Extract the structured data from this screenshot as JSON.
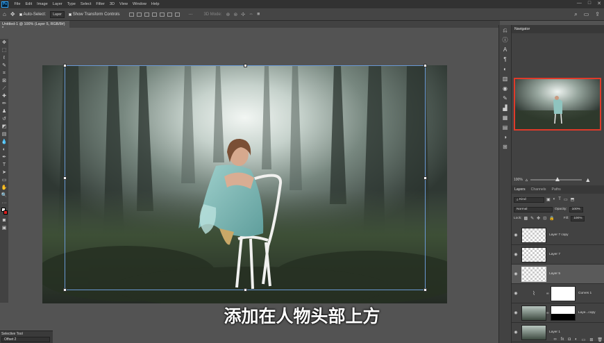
{
  "app": {
    "logo": "Ps",
    "window_controls": [
      "—",
      "□",
      "✕"
    ]
  },
  "menu": [
    "File",
    "Edit",
    "Image",
    "Layer",
    "Type",
    "Select",
    "Filter",
    "3D",
    "View",
    "Window",
    "Help"
  ],
  "options": {
    "auto_select_label": "Auto-Select:",
    "auto_select_value": "Layer",
    "show_transform_label": "Show Transform Controls",
    "mode_3d_label": "3D Mode:",
    "more_label": "···"
  },
  "document": {
    "tab_title": "Untitled-1 @ 100% (Layer 5, RGB/8#) *"
  },
  "subtitle": "添加在人物头部上方",
  "navigator": {
    "title": "Navigator",
    "zoom": "100%"
  },
  "layers_panel": {
    "tabs": [
      "Layers",
      "Channels",
      "Paths"
    ],
    "kind": "Kind",
    "blend_mode": "Normal",
    "opacity_label": "Opacity:",
    "opacity": "100%",
    "lock_label": "Lock:",
    "fill_label": "Fill:",
    "fill": "100%",
    "layers": [
      {
        "name": "Layer 7 copy"
      },
      {
        "name": "Layer 7"
      },
      {
        "name": "Layer 5"
      },
      {
        "name": "Curves 1"
      },
      {
        "name": "Laye...copy"
      },
      {
        "name": "Layer 1"
      }
    ]
  },
  "mini_panel": {
    "title": "Selective Tool",
    "value": "Offset 2"
  },
  "colors": {
    "accent": "#31a8ff",
    "selection_border": "#e03a2a"
  }
}
